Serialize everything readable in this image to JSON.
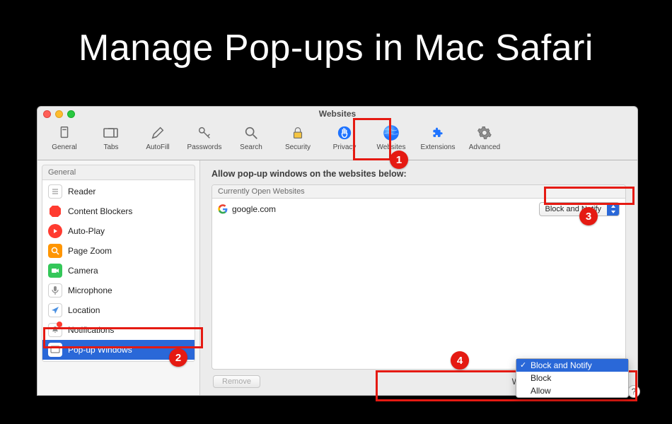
{
  "slide_title": "Manage Pop-ups in Mac Safari",
  "window_title": "Websites",
  "toolbar": [
    {
      "id": "general",
      "label": "General"
    },
    {
      "id": "tabs",
      "label": "Tabs"
    },
    {
      "id": "autofill",
      "label": "AutoFill"
    },
    {
      "id": "passwords",
      "label": "Passwords"
    },
    {
      "id": "search",
      "label": "Search"
    },
    {
      "id": "security",
      "label": "Security"
    },
    {
      "id": "privacy",
      "label": "Privacy"
    },
    {
      "id": "websites",
      "label": "Websites"
    },
    {
      "id": "extensions",
      "label": "Extensions"
    },
    {
      "id": "advanced",
      "label": "Advanced"
    }
  ],
  "sidebar": {
    "group_label": "General",
    "items": [
      {
        "id": "reader",
        "label": "Reader",
        "icon_bg": "#ffffff",
        "icon_stroke": "#9a9a9a"
      },
      {
        "id": "content-blockers",
        "label": "Content Blockers",
        "icon_bg": "#ff3b30"
      },
      {
        "id": "auto-play",
        "label": "Auto-Play",
        "icon_bg": "#ff3b30"
      },
      {
        "id": "page-zoom",
        "label": "Page Zoom",
        "icon_bg": "#ff9500"
      },
      {
        "id": "camera",
        "label": "Camera",
        "icon_bg": "#34c759"
      },
      {
        "id": "microphone",
        "label": "Microphone",
        "icon_bg": "#ffffff",
        "icon_stroke": "#9a9a9a"
      },
      {
        "id": "location",
        "label": "Location",
        "icon_bg": "#ffffff",
        "icon_stroke": "#9a9a9a"
      },
      {
        "id": "notifications",
        "label": "Notifications",
        "icon_bg": "#ffffff",
        "icon_stroke": "#9a9a9a",
        "badge": true
      },
      {
        "id": "popup-windows",
        "label": "Pop-up Windows",
        "icon_bg": "#ffffff",
        "icon_stroke": "#9a9a9a",
        "selected": true
      }
    ]
  },
  "main": {
    "heading": "Allow pop-up windows on the websites below:",
    "table_header": "Currently Open Websites",
    "rows": [
      {
        "site": "google.com",
        "setting": "Block and Notify"
      }
    ],
    "remove_label": "Remove",
    "other_label": "When visiting other websites:",
    "dropdown": {
      "options": [
        "Block and Notify",
        "Block",
        "Allow"
      ],
      "selected": "Block and Notify"
    },
    "help": "?"
  },
  "annotations": {
    "badge1": "1",
    "badge2": "2",
    "badge3": "3",
    "badge4": "4"
  },
  "colors": {
    "annotation_red": "#e51a12",
    "selection_blue": "#2a68d8"
  }
}
